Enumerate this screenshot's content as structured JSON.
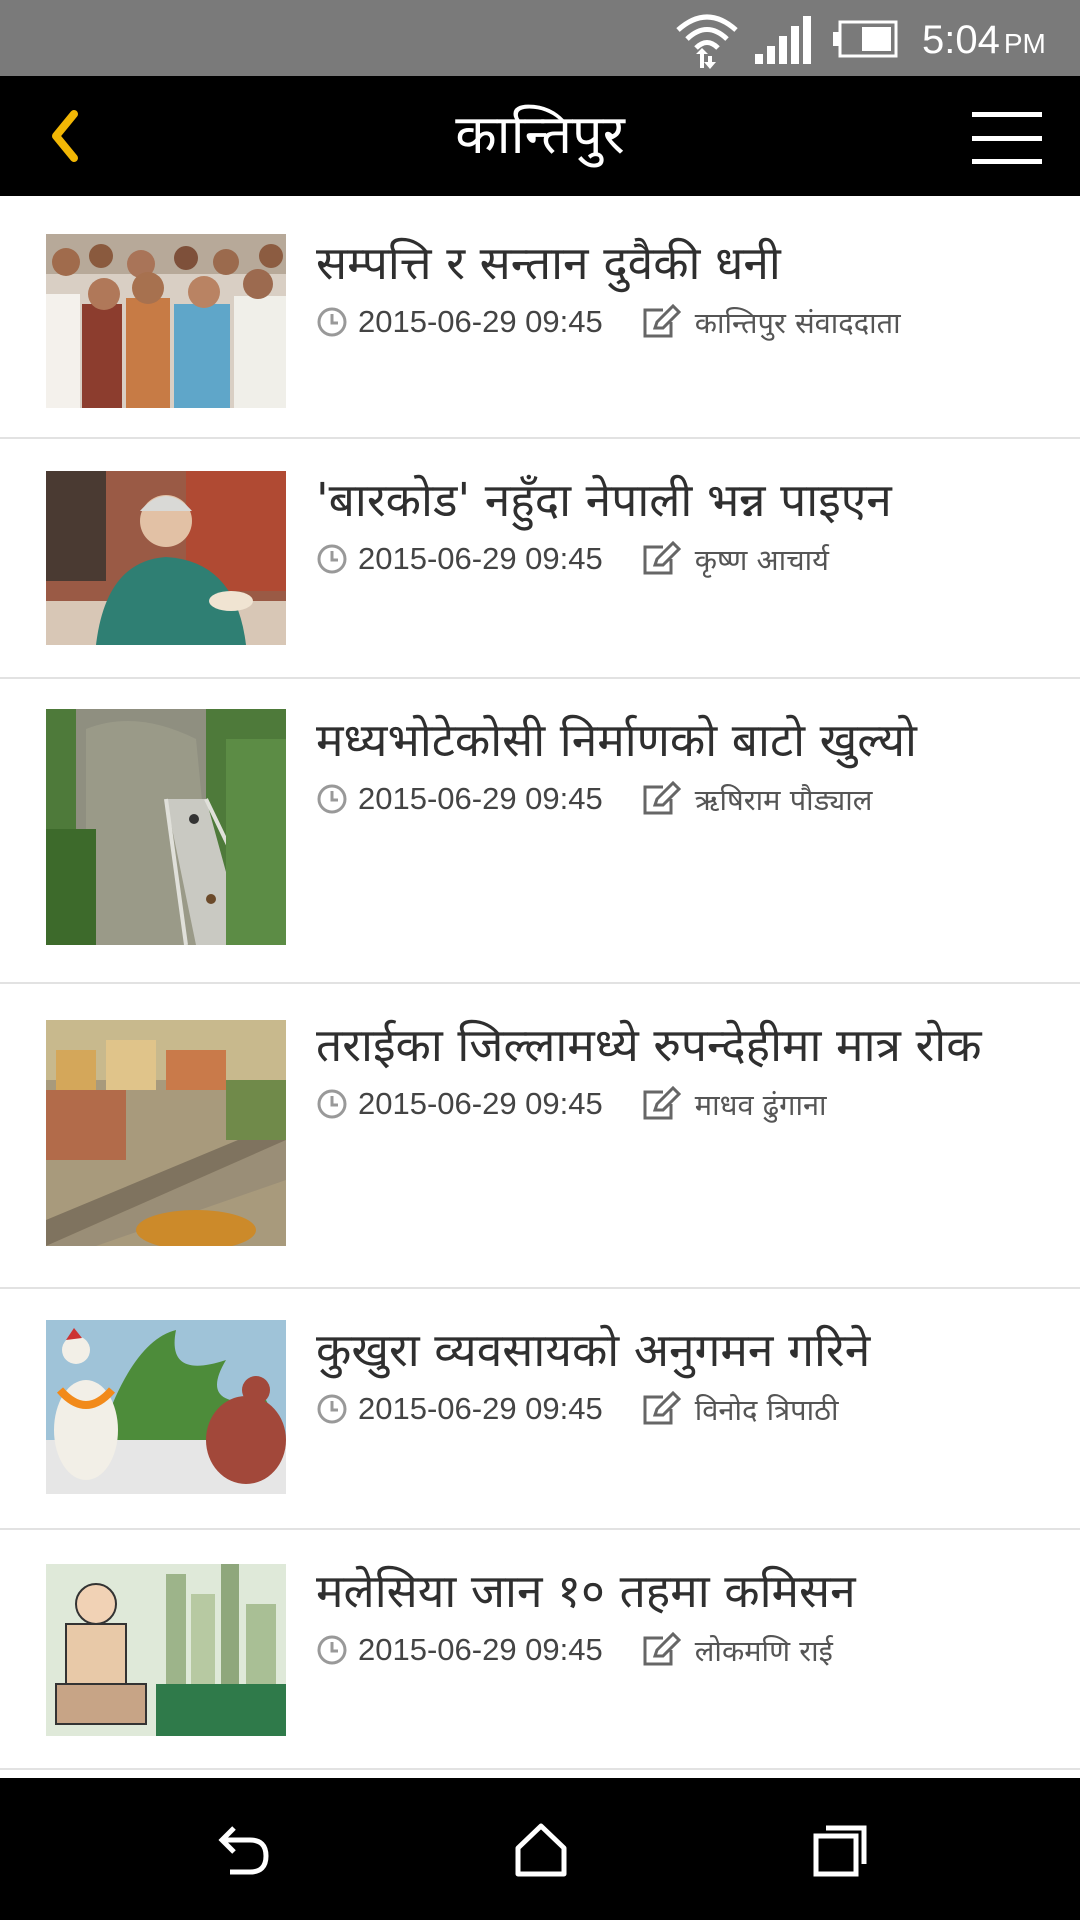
{
  "status_bar": {
    "time": "5:04",
    "ampm": "PM",
    "icons": [
      "wifi-icon",
      "signal-icon",
      "battery-icon"
    ]
  },
  "app_bar": {
    "title": "कान्तिपुर",
    "back_icon": "chevron-left-icon",
    "menu_icon": "hamburger-menu-icon",
    "accent_color": "#f2b705"
  },
  "news": [
    {
      "headline": "सम्पत्ति र सन्तान दुवैकी धनी",
      "date": "2015-06-29 09:45",
      "author": "कान्तिपुर संवाददाता",
      "thumb": "crowd-photo"
    },
    {
      "headline": "'बारकोड' नहुँदा नेपाली भन्न पाइएन",
      "date": "2015-06-29 09:45",
      "author": "कृष्ण आचार्य",
      "thumb": "woman-tea-photo"
    },
    {
      "headline": "मध्यभोटेकोसी निर्माणको बाटो खुल्यो",
      "date": "2015-06-29 09:45",
      "author": "ऋषिराम पौड्याल",
      "thumb": "bridge-photo"
    },
    {
      "headline": "तराईका जिल्लामध्ये रुपन्देहीमा मात्र रोक",
      "date": "2015-06-29 09:45",
      "author": "माधव ढुंगाना",
      "thumb": "city-aerial-photo"
    },
    {
      "headline": "कुखुरा व्यवसायको अनुगमन गरिने",
      "date": "2015-06-29 09:45",
      "author": "विनोद त्रिपाठी",
      "thumb": "chicken-statues-photo"
    },
    {
      "headline": "मलेसिया जान १० तहमा कमिसन",
      "date": "2015-06-29 09:45",
      "author": "लोकमणि राई",
      "thumb": "cartoon-man-photo"
    }
  ],
  "nav_bar": {
    "icons": [
      "back-icon",
      "home-icon",
      "recent-apps-icon"
    ]
  }
}
